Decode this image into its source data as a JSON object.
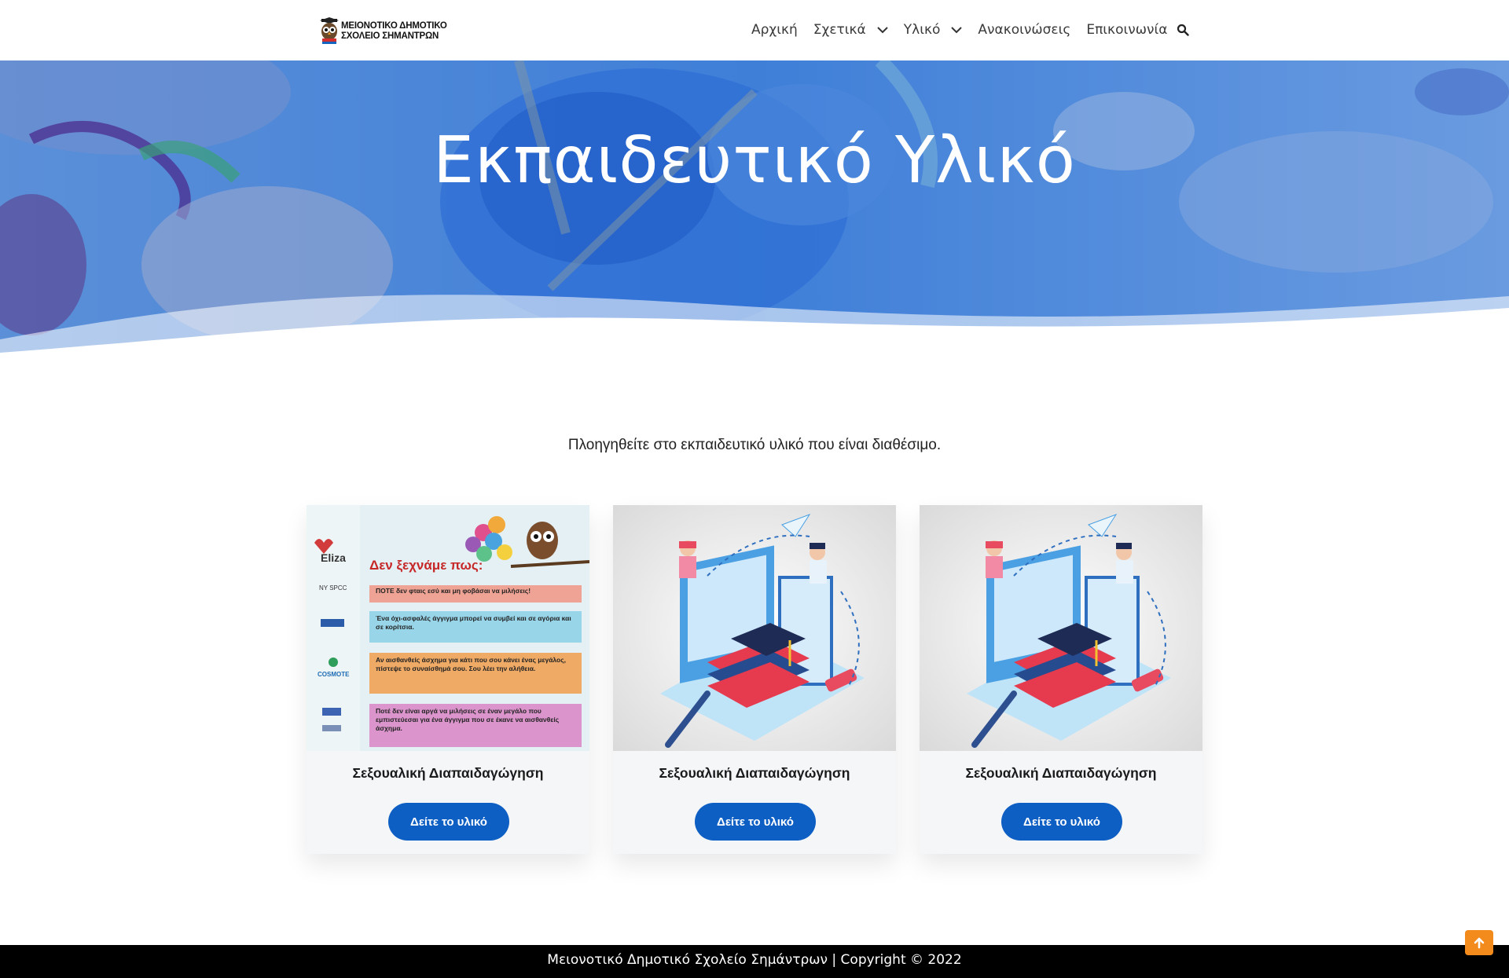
{
  "header": {
    "logo_line1": "ΜΕΙΟΝΟΤΙΚΟ ΔΗΜΟΤΙΚΟ",
    "logo_line2": "ΣΧΟΛΕΙΟ ΣΗΜΑΝΤΡΩΝ",
    "nav": [
      {
        "label": "Αρχική",
        "icon": ""
      },
      {
        "label": "Σχετικά",
        "icon": "chevron-down-icon"
      },
      {
        "label": "Υλικό",
        "icon": "chevron-down-icon"
      },
      {
        "label": "Ανακοινώσεις",
        "icon": ""
      },
      {
        "label": "Επικοινωνία",
        "icon": ""
      }
    ],
    "search_icon": "search-icon"
  },
  "hero": {
    "title": "Εκπαιδευτικό Υλικό",
    "overlay_color": "#3d7fd6"
  },
  "intro": "Πλοηγηθείτε στο εκπαιδευτικό υλικό που είναι διαθέσιμο.",
  "cards": [
    {
      "title": "Σεξουαλική Διαπαιδαγώγηση",
      "button": "Δείτε το υλικό",
      "poster": {
        "heading": "Δεν ξεχνάμε πως:",
        "brand": "Eliza",
        "sponsor": "COSMOTE",
        "lines": [
          "ΠΟΤΕ δεν φταις εσύ και μη φοβάσαι να μιλήσεις!",
          "Ένα όχι-ασφαλές άγγιγμα μπορεί να συμβεί και σε αγόρια και σε κορίτσια.",
          "Αν αισθανθείς άσχημα για κάτι που σου κάνει ένας μεγάλος, πίστεψε το συναίσθημά σου. Σου λέει την αλήθεια.",
          "Ποτέ δεν είναι αργά να μιλήσεις σε έναν μεγάλο που εμπιστεύεσαι για ένα άγγιγμα που σε έκανε να αισθανθείς άσχημα."
        ]
      }
    },
    {
      "title": "Σεξουαλική Διαπαιδαγώγηση",
      "button": "Δείτε το υλικό"
    },
    {
      "title": "Σεξουαλική Διαπαιδαγώγηση",
      "button": "Δείτε το υλικό"
    }
  ],
  "footer": {
    "text": "Μειονοτικό Δημοτικό Σχολείο Σημάντρων | Copyright © 2022"
  },
  "colors": {
    "accent": "#0e5fc4",
    "scroll_top": "#f28a1c",
    "footer_bg": "#000000"
  }
}
